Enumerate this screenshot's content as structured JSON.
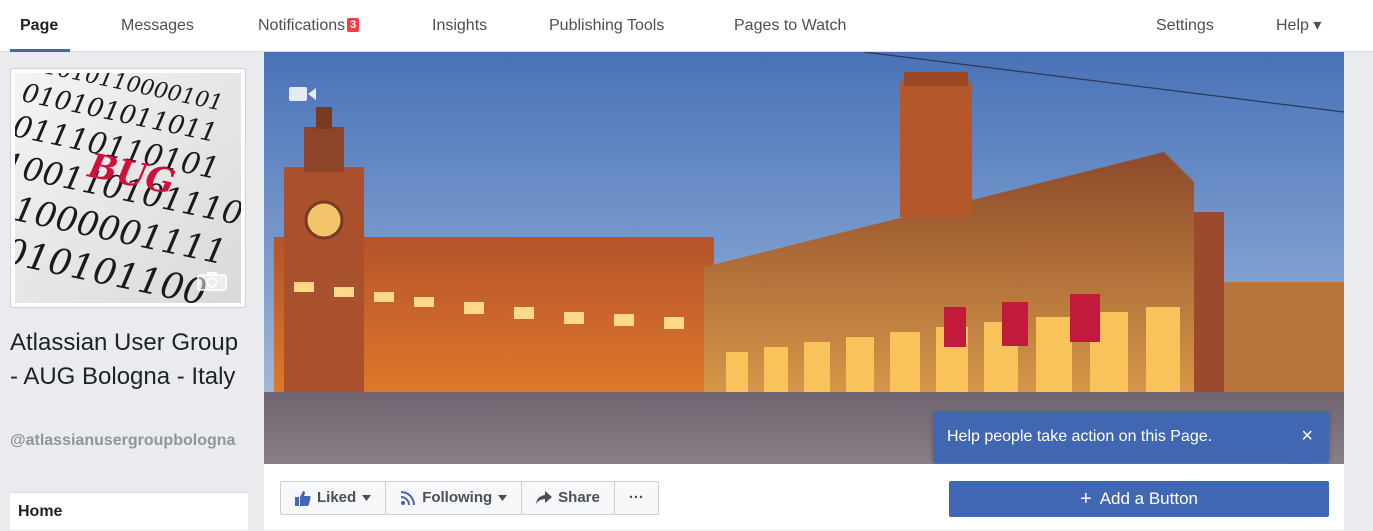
{
  "nav": {
    "tabs": [
      {
        "label": "Page"
      },
      {
        "label": "Messages"
      },
      {
        "label": "Notifications",
        "badge": "3"
      },
      {
        "label": "Insights"
      },
      {
        "label": "Publishing Tools"
      },
      {
        "label": "Pages to Watch"
      }
    ],
    "settings": "Settings",
    "help": "Help ▾"
  },
  "profile": {
    "image_text": {
      "binary_lines": [
        "11010110000101",
        "010101011011",
        "01110110101",
        "100110101110",
        "01000001111",
        "1010101100"
      ],
      "highlight": "BUG"
    },
    "camera_icon": "camera-icon",
    "name": "Atlassian User Group - AUG Bologna - Italy",
    "handle": "@atlassianusergroupbologna"
  },
  "left_nav": {
    "home": "Home"
  },
  "cover": {
    "video_icon": "video-camera-icon"
  },
  "actions": {
    "liked": "Liked",
    "following": "Following",
    "share": "Share",
    "more": "···",
    "add_button": "Add a Button"
  },
  "tooltip": {
    "text": "Help people take action on this Page.",
    "close": "×"
  },
  "colors": {
    "accent": "#4267b2",
    "badge": "#fa3e3e",
    "background": "#e9ebee"
  }
}
